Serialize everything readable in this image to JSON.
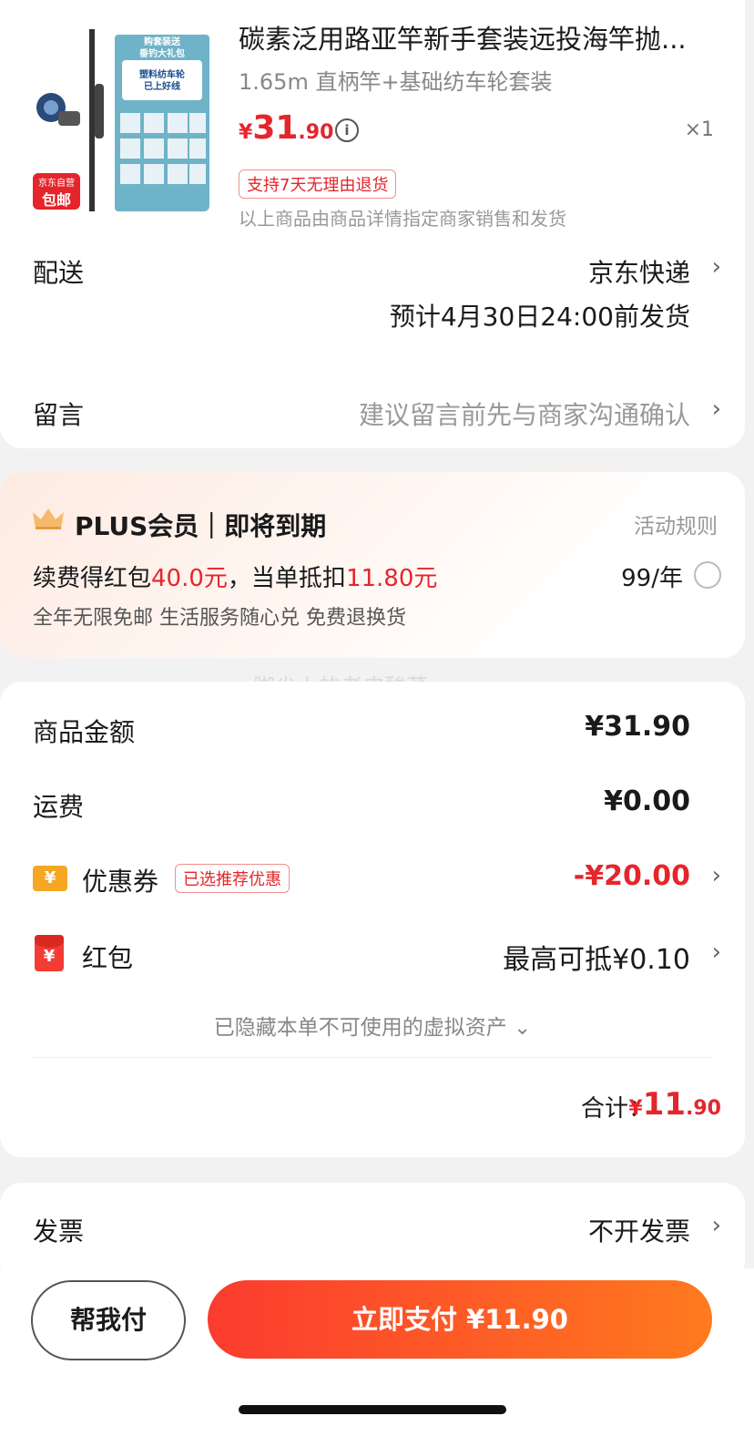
{
  "product": {
    "title": "碳素泛用路亚竿新手套装远投海竿抛...",
    "spec": "1.65m 直柄竿+基础纺车轮套装",
    "price_symbol": "¥",
    "price_int": "31",
    "price_dec": ".90",
    "quantity": "×1",
    "return_tag": "支持7天无理由退货",
    "seller_note": "以上商品由商品详情指定商家销售和发货",
    "thumb": {
      "banner": "购套装送\n垂钓大礼包",
      "card": "塑料纺车轮\n已上好线",
      "badge_top": "京东自营",
      "badge_bottom": "包邮"
    }
  },
  "delivery": {
    "label": "配送",
    "method": "京东快递",
    "estimate": "预计4月30日24:00前发货"
  },
  "message": {
    "label": "留言",
    "placeholder": "建议留言前先与商家沟通确认"
  },
  "plus": {
    "title": "PLUS会员｜即将到期",
    "rules": "活动规则",
    "line1_a": "续费得红包",
    "line1_b": "40.0元",
    "line1_c": "，当单抵扣",
    "line1_d": "11.80元",
    "price": "99/年",
    "benefits": "全年无限免邮 生活服务随心兑 免费退换货",
    "watermark": "脚尖上的老皮酸菜"
  },
  "summary": {
    "goods_label": "商品金额",
    "goods_value": "¥31.90",
    "shipping_label": "运费",
    "shipping_value": "¥0.00",
    "coupon_label": "优惠券",
    "coupon_badge": "已选推荐优惠",
    "coupon_value": "-¥20.00",
    "redpacket_label": "红包",
    "redpacket_value": "最高可抵¥0.10",
    "hidden_note": "已隐藏本单不可使用的虚拟资产",
    "total_label": "合计：",
    "total_symbol": "¥",
    "total_int": "11",
    "total_dec": ".90"
  },
  "invoice": {
    "label": "发票",
    "value": "不开发票"
  },
  "footer": {
    "help_pay": "帮我付",
    "pay_now": "立即支付 ¥11.90"
  },
  "icons": {
    "chevron": "›",
    "info": "i",
    "yen": "¥",
    "expand": "⌄"
  }
}
